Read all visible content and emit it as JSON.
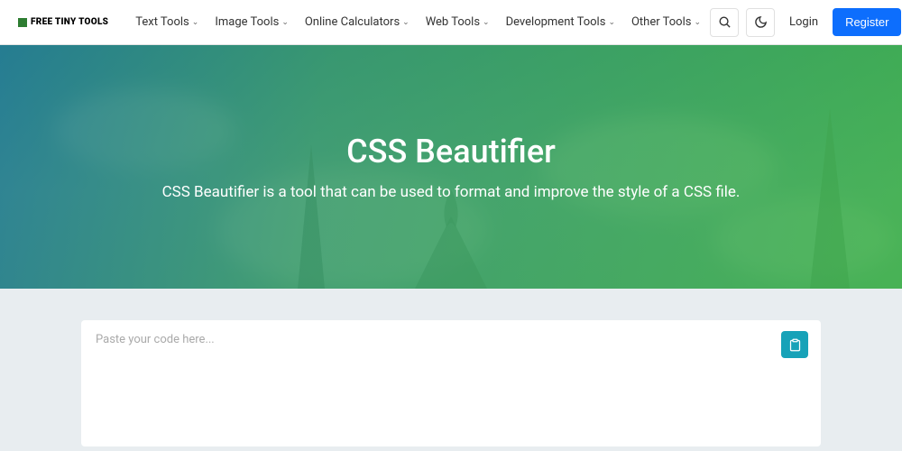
{
  "brand": {
    "name": "FREE TINY TOOLS"
  },
  "nav": {
    "items": [
      {
        "label": "Text Tools"
      },
      {
        "label": "Image Tools"
      },
      {
        "label": "Online Calculators"
      },
      {
        "label": "Web Tools"
      },
      {
        "label": "Development Tools"
      },
      {
        "label": "Other Tools"
      }
    ],
    "login": "Login",
    "register": "Register"
  },
  "hero": {
    "title": "CSS Beautifier",
    "subtitle": "CSS Beautifier is a tool that can be used to format and improve the style of a CSS file."
  },
  "editor": {
    "placeholder": "Paste your code here..."
  }
}
